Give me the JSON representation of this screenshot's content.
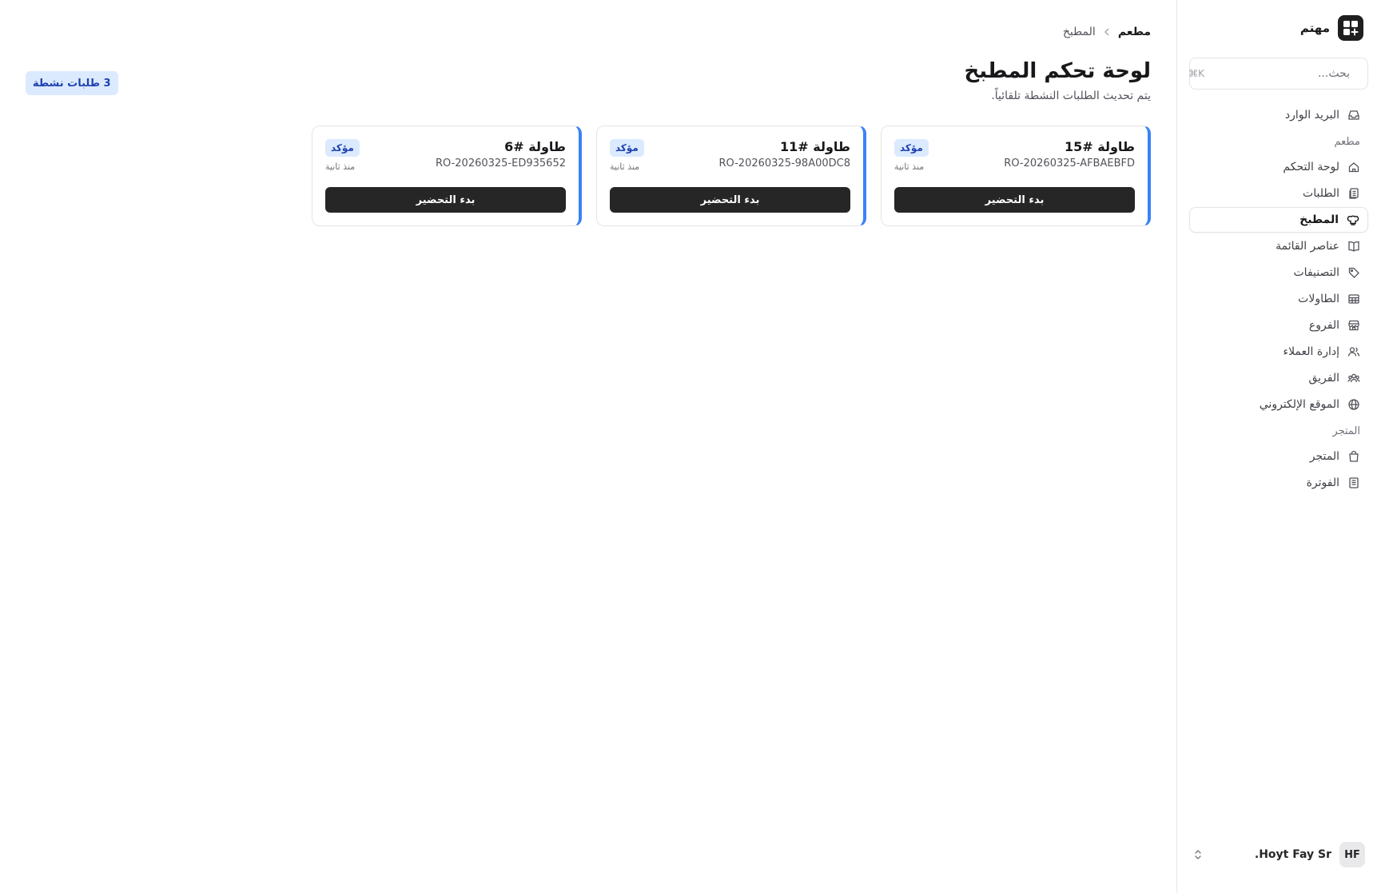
{
  "app": {
    "name": "مهتم"
  },
  "search": {
    "placeholder": "بحث...",
    "shortcut": "⌘K"
  },
  "sidebar": {
    "top_items": [
      {
        "label": "البريد الوارد",
        "icon": "inbox-icon"
      }
    ],
    "sections": [
      {
        "label": "مطعم",
        "items": [
          {
            "label": "لوحة التحكم",
            "icon": "home-icon",
            "active": false
          },
          {
            "label": "الطلبات",
            "icon": "orders-icon",
            "active": false
          },
          {
            "label": "المطبخ",
            "icon": "chef-hat-icon",
            "active": true
          },
          {
            "label": "عناصر القائمة",
            "icon": "book-icon",
            "active": false
          },
          {
            "label": "التصنيفات",
            "icon": "tag-icon",
            "active": false
          },
          {
            "label": "الطاولات",
            "icon": "table-icon",
            "active": false
          },
          {
            "label": "الفروع",
            "icon": "store-icon",
            "active": false
          },
          {
            "label": "إدارة العملاء",
            "icon": "users-icon",
            "active": false
          },
          {
            "label": "الفريق",
            "icon": "team-icon",
            "active": false
          },
          {
            "label": "الموقع الإلكتروني",
            "icon": "globe-icon",
            "active": false
          }
        ]
      },
      {
        "label": "المتجر",
        "items": [
          {
            "label": "المتجر",
            "icon": "shopping-bag-icon",
            "active": false
          },
          {
            "label": "الفوترة",
            "icon": "receipt-icon",
            "active": false
          }
        ]
      }
    ]
  },
  "user": {
    "initials": "HF",
    "name": "Hoyt Fay Sr."
  },
  "breadcrumb": {
    "root": "مطعم",
    "current": "المطبخ"
  },
  "page": {
    "title": "لوحة تحكم المطبخ",
    "subtitle": "يتم تحديث الطلبات النشطة تلقائياً.",
    "active_count_badge": "3 طلبات نشطة"
  },
  "orders": [
    {
      "table": "طاولة #15",
      "id": "RO-20260325-AFBAEBFD",
      "status": "مؤكد",
      "time": "منذ ثانية",
      "action": "بدء التحضير"
    },
    {
      "table": "طاولة #11",
      "id": "RO-20260325-98A00DC8",
      "status": "مؤكد",
      "time": "منذ ثانية",
      "action": "بدء التحضير"
    },
    {
      "table": "طاولة #6",
      "id": "RO-20260325-ED935652",
      "status": "مؤكد",
      "time": "منذ ثانية",
      "action": "بدء التحضير"
    }
  ],
  "colors": {
    "accent": "#3b82f6",
    "badge_bg": "#dbeafe",
    "badge_text": "#1e40af",
    "button_bg": "#262626"
  }
}
